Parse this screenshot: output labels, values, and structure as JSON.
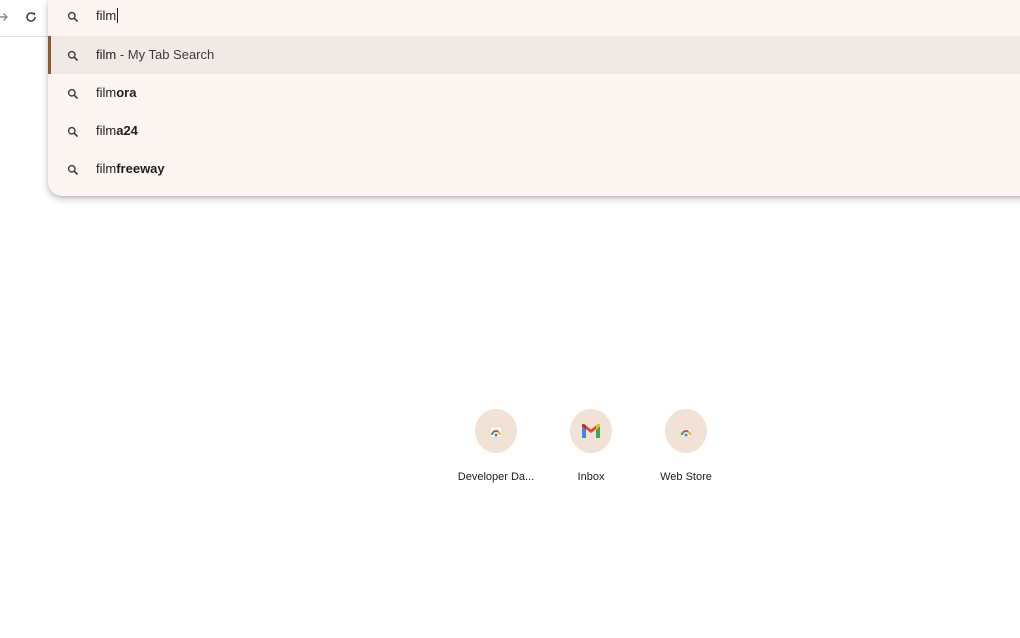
{
  "toolbar": {
    "forward_icon": "forward-arrow-icon",
    "reload_icon": "reload-icon"
  },
  "omnibox": {
    "input_value": "film",
    "search_icon": "search-icon",
    "suggestions": [
      {
        "typed": "film",
        "rest": "",
        "desc": " - My Tab Search",
        "selected": true
      },
      {
        "typed": "film",
        "rest": "ora",
        "desc": "",
        "selected": false
      },
      {
        "typed": "film",
        "rest": "a24",
        "desc": "",
        "selected": false
      },
      {
        "typed": "film",
        "rest": "freeway",
        "desc": "",
        "selected": false
      }
    ]
  },
  "shortcuts": [
    {
      "label": "Developer Da...",
      "icon": "chrome-web-store-icon"
    },
    {
      "label": "Inbox",
      "icon": "gmail-icon"
    },
    {
      "label": "Web Store",
      "icon": "chrome-web-store-icon"
    }
  ],
  "colors": {
    "dropdown_bg": "#fdf5f2",
    "selected_row_bg": "#f0e9e6",
    "selection_bar": "#8a5a33",
    "shortcut_circle": "#f1e2d5"
  }
}
